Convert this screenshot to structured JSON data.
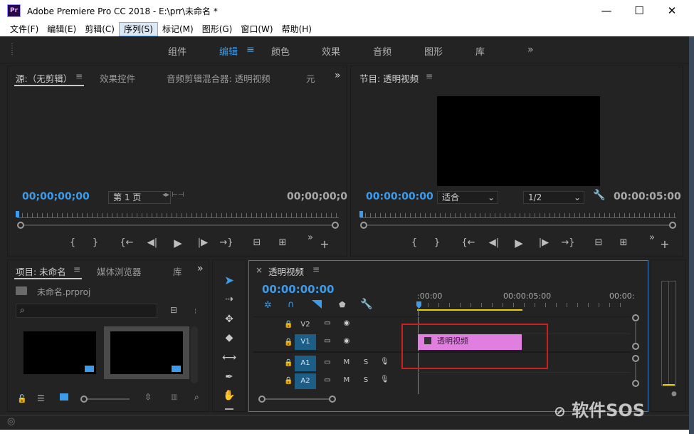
{
  "window": {
    "app_icon": "Pr",
    "title": "Adobe Premiere Pro CC 2018 - E:\\prr\\未命名 *",
    "controls": {
      "minimize": "—",
      "maximize": "☐",
      "close": "✕"
    }
  },
  "menu": [
    "文件(F)",
    "编辑(E)",
    "剪辑(C)",
    "序列(S)",
    "标记(M)",
    "图形(G)",
    "窗口(W)",
    "帮助(H)"
  ],
  "workspaces": {
    "items": [
      "组件",
      "编辑",
      "颜色",
      "效果",
      "音频",
      "图形",
      "库"
    ],
    "active": "编辑",
    "more": "»"
  },
  "source_panel": {
    "tabs": [
      "源:（无剪辑）",
      "效果控件",
      "音频剪辑混合器: 透明视频",
      "元"
    ],
    "more": "»",
    "timecode_left": "00;00;00;00",
    "page_select": "第 1 页",
    "timecode_right": "00;00;00;0"
  },
  "program_panel": {
    "title": "节目: 透明视频",
    "timecode_left": "00:00:00:00",
    "fit_select": "适合",
    "res_select": "1/2",
    "timecode_right": "00:00:05:00"
  },
  "transport": {
    "mark_in": "{",
    "mark_out": "}",
    "go_in": "{←",
    "step_back": "◀|",
    "play": "▶",
    "step_fwd": "|▶",
    "go_out": "→}",
    "lift": "⊟",
    "extract": "⊞",
    "more": "»",
    "add": "+"
  },
  "project_panel": {
    "tabs": [
      "项目: 未命名",
      "媒体浏览器",
      "库"
    ],
    "more": "»",
    "file": "未命名.prproj"
  },
  "timeline": {
    "close": "×",
    "title": "透明视频",
    "menu": "≡",
    "timecode": "00:00:00:00",
    "ruler": [
      ":00:00",
      "00:00:05:00",
      "00:00:"
    ],
    "tracks": [
      {
        "name": "V2",
        "tools": [
          "▭",
          "◉"
        ]
      },
      {
        "name": "V1",
        "tools": [
          "▭",
          "◉"
        ]
      },
      {
        "name": "A1",
        "tools": [
          "▭",
          "M",
          "S",
          "🎙"
        ]
      },
      {
        "name": "A2",
        "tools": [
          "▭",
          "M",
          "S",
          "🎙"
        ]
      }
    ],
    "clip": {
      "label": "透明视频",
      "color": "#e07fe0"
    },
    "highlight_color": "#cc2020"
  },
  "watermark": "软件SOS",
  "colors": {
    "accent": "#3d9be9",
    "panel_bg": "#232323",
    "clip_pink": "#e07fe0"
  }
}
